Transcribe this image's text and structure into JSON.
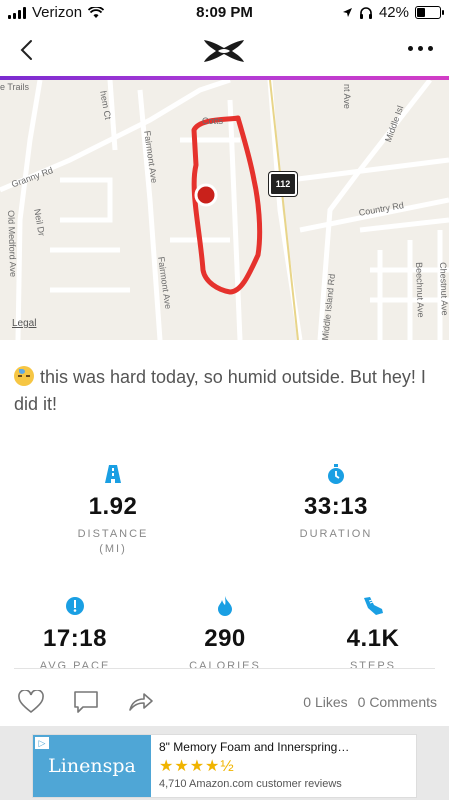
{
  "status_bar": {
    "carrier": "Verizon",
    "time": "8:09 PM",
    "battery": "42%",
    "battery_level": 0.42
  },
  "map": {
    "labels": [
      "e Trails",
      "hem Ct",
      "Granny Rd",
      "Old Medford Ave",
      "Neil Dr",
      "Fairmont Ave",
      "Fairmont Ave",
      "Middle Island Rd",
      "Middle Isl",
      "Country Rd",
      "Beechnut Ave",
      "Chestnut Ave",
      "nt Ave",
      "Cotts"
    ],
    "route_shield": "112",
    "legal": "Legal"
  },
  "caption": "this was hard today, so humid outside. But hey! I did it!",
  "stats": {
    "distance": {
      "value": "1.92",
      "label": "DISTANCE",
      "unit": "(MI)"
    },
    "duration": {
      "value": "33:13",
      "label": "DURATION"
    },
    "avg_pace": {
      "value": "17:18",
      "label": "AVG PACE"
    },
    "calories": {
      "value": "290",
      "label": "CALORIES"
    },
    "steps": {
      "value": "4.1K",
      "label": "STEPS"
    }
  },
  "social": {
    "likes": "0 Likes",
    "comments": "0 Comments"
  },
  "ad": {
    "brand": "Linenspa",
    "title": "8\" Memory Foam and Innerspring…",
    "stars": "★★★★½",
    "reviews": "4,710 Amazon.com customer reviews"
  },
  "colors": {
    "accent_blue": "#1a9fe3",
    "route_red": "#e5322d",
    "gradient_start": "#7a2bd0",
    "gradient_end": "#d23dc6"
  }
}
